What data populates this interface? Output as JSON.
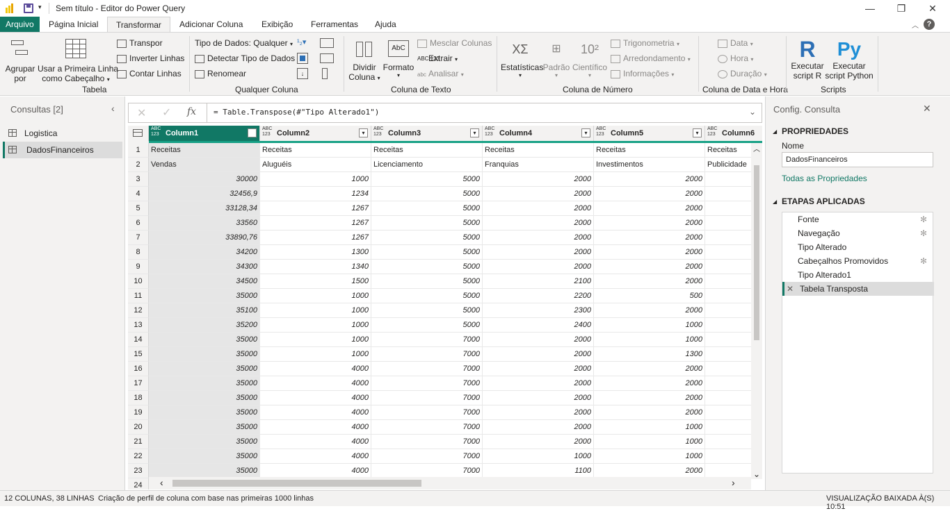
{
  "title": "Sem título - Editor do Power Query",
  "tabs": [
    "Arquivo",
    "Página Inicial",
    "Transformar",
    "Adicionar Coluna",
    "Exibição",
    "Ferramentas",
    "Ajuda"
  ],
  "ribbon": {
    "tabela": {
      "agrupar_1": "Agrupar",
      "agrupar_2": "por",
      "primeira_1": "Usar a Primeira Linha",
      "primeira_2": "como Cabeçalho",
      "transpor": "Transpor",
      "inverter": "Inverter Linhas",
      "contar": "Contar Linhas",
      "label": "Tabela"
    },
    "qualquer": {
      "tipo": "Tipo de Dados: Qualquer",
      "detectar": "Detectar Tipo de Dados",
      "renomear": "Renomear",
      "label": "Qualquer Coluna"
    },
    "texto": {
      "dividir_1": "Dividir",
      "dividir_2": "Coluna",
      "formato": "Formato",
      "mesclar": "Mesclar Colunas",
      "extrair": "Extrair",
      "analisar": "Analisar",
      "label": "Coluna de Texto"
    },
    "numero": {
      "estatisticas": "Estatísticas",
      "padrao": "Padrão",
      "cientifico": "Científico",
      "trig": "Trigonometria",
      "arred": "Arredondamento",
      "info": "Informações",
      "label": "Coluna de Número"
    },
    "data": {
      "data": "Data",
      "hora": "Hora",
      "duracao": "Duração",
      "label": "Coluna de Data e Hora"
    },
    "scripts": {
      "r_1": "Executar",
      "r_2": "script R",
      "py_1": "Executar",
      "py_2": "script Python",
      "label": "Scripts"
    }
  },
  "queries": {
    "header": "Consultas [2]",
    "items": [
      "Logistica",
      "DadosFinanceiros"
    ]
  },
  "formula": "= Table.Transpose(#\"Tipo Alterado1\")",
  "columns": [
    "Column1",
    "Column2",
    "Column3",
    "Column4",
    "Column5",
    "Column6"
  ],
  "type_icon_1": "ABC",
  "type_icon_2": "123",
  "rows": [
    [
      "1",
      "Receitas",
      "Receitas",
      "Receitas",
      "Receitas",
      "Receitas",
      "Receitas"
    ],
    [
      "2",
      "Vendas",
      "Aluguéis",
      "Licenciamento",
      "Franquias",
      "Investimentos",
      "Publicidade"
    ],
    [
      "3",
      "30000",
      "1000",
      "5000",
      "2000",
      "2000",
      ""
    ],
    [
      "4",
      "32456,9",
      "1234",
      "5000",
      "2000",
      "2000",
      ""
    ],
    [
      "5",
      "33128,34",
      "1267",
      "5000",
      "2000",
      "2000",
      ""
    ],
    [
      "6",
      "33560",
      "1267",
      "5000",
      "2000",
      "2000",
      ""
    ],
    [
      "7",
      "33890,76",
      "1267",
      "5000",
      "2000",
      "2000",
      ""
    ],
    [
      "8",
      "34200",
      "1300",
      "5000",
      "2000",
      "2000",
      ""
    ],
    [
      "9",
      "34300",
      "1340",
      "5000",
      "2000",
      "2000",
      ""
    ],
    [
      "10",
      "34500",
      "1500",
      "5000",
      "2100",
      "2000",
      ""
    ],
    [
      "11",
      "35000",
      "1000",
      "5000",
      "2200",
      "500",
      ""
    ],
    [
      "12",
      "35100",
      "1000",
      "5000",
      "2300",
      "2000",
      ""
    ],
    [
      "13",
      "35200",
      "1000",
      "5000",
      "2400",
      "1000",
      ""
    ],
    [
      "14",
      "35000",
      "1000",
      "7000",
      "2000",
      "1000",
      ""
    ],
    [
      "15",
      "35000",
      "1000",
      "7000",
      "2000",
      "1300",
      ""
    ],
    [
      "16",
      "35000",
      "4000",
      "7000",
      "2000",
      "2000",
      ""
    ],
    [
      "17",
      "35000",
      "4000",
      "7000",
      "2000",
      "2000",
      ""
    ],
    [
      "18",
      "35000",
      "4000",
      "7000",
      "2000",
      "2000",
      ""
    ],
    [
      "19",
      "35000",
      "4000",
      "7000",
      "2000",
      "2000",
      ""
    ],
    [
      "20",
      "35000",
      "4000",
      "7000",
      "2000",
      "1000",
      ""
    ],
    [
      "21",
      "35000",
      "4000",
      "7000",
      "2000",
      "1000",
      ""
    ],
    [
      "22",
      "35000",
      "4000",
      "7000",
      "1000",
      "1000",
      ""
    ],
    [
      "23",
      "35000",
      "4000",
      "7000",
      "1100",
      "2000",
      ""
    ],
    [
      "24",
      "",
      "",
      "",
      "",
      "",
      ""
    ]
  ],
  "settings": {
    "title": "Config. Consulta",
    "props": "PROPRIEDADES",
    "name_label": "Nome",
    "name_value": "DadosFinanceiros",
    "all_props": "Todas as Propriedades",
    "steps_header": "ETAPAS APLICADAS",
    "steps": [
      "Fonte",
      "Navegação",
      "Tipo Alterado",
      "Cabeçalhos Promovidos",
      "Tipo Alterado1",
      "Tabela Transposta"
    ]
  },
  "status": {
    "left": "12 COLUNAS, 38 LINHAS",
    "middle": "Criação de perfil de coluna com base nas primeiras 1000 linhas",
    "right": "VISUALIZAÇÃO BAIXADA À(S) 10:51"
  },
  "colors": {
    "accent": "#117865",
    "quality": "#16a085",
    "r_blue": "#2c6fb5",
    "py_blue": "#1f8fd6"
  }
}
